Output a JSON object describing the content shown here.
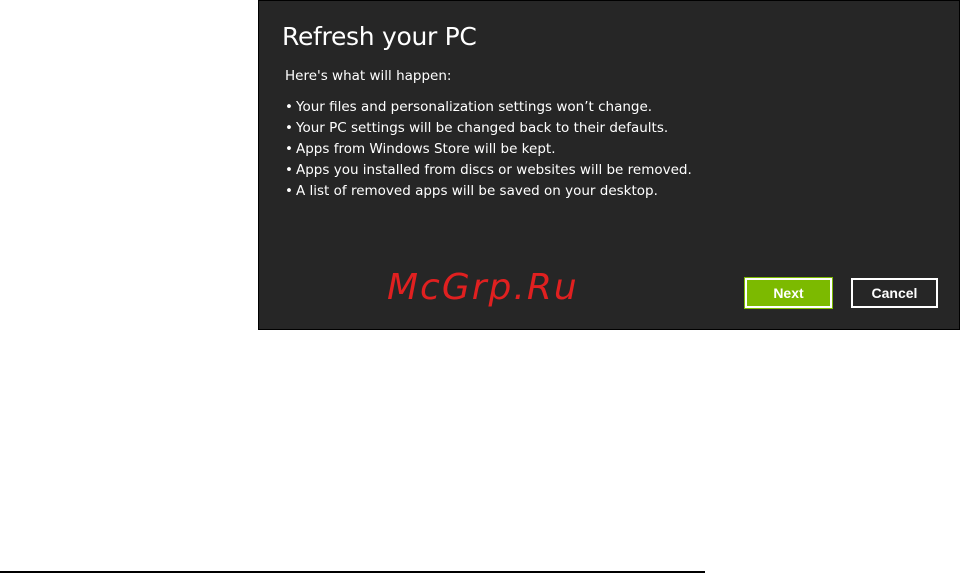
{
  "dialog": {
    "title": "Refresh your PC",
    "intro": "Here's what will happen:",
    "bullet_char": "•",
    "items": [
      "Your files and personalization settings won’t change.",
      "Your PC settings will be changed back to their defaults.",
      "Apps from Windows Store will be kept.",
      "Apps you installed from discs or websites will be removed.",
      "A list of removed apps will be saved on your desktop."
    ],
    "buttons": {
      "next_label": "Next",
      "cancel_label": "Cancel"
    }
  },
  "watermark": {
    "text": "McGrp.Ru"
  },
  "colors": {
    "dialog_background": "#262626",
    "accent_next": "#7cba00",
    "watermark": "#e02020"
  }
}
